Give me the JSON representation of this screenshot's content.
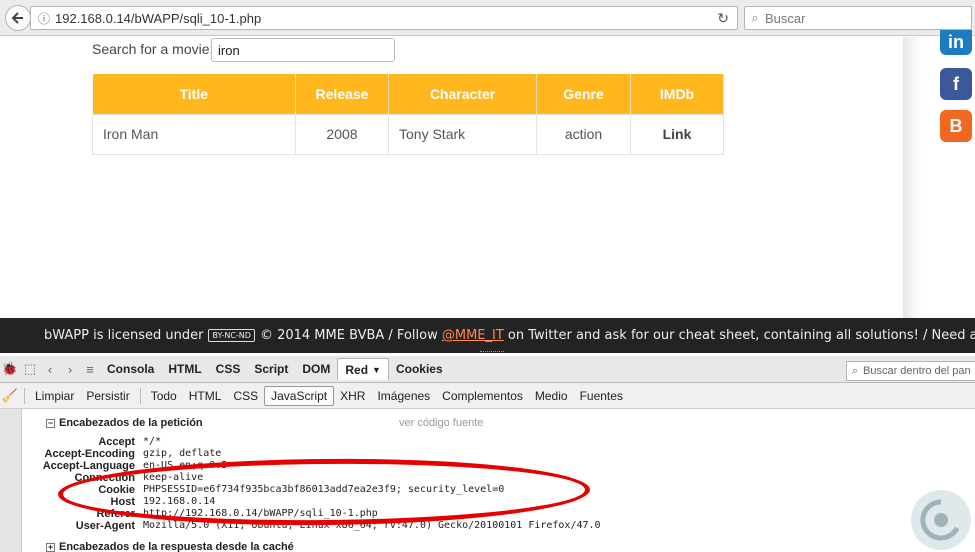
{
  "browser": {
    "url": "192.168.0.14/bWAPP/sqli_10-1.php",
    "search_placeholder": "Buscar"
  },
  "page": {
    "search_label": "Search for a movie:",
    "search_value": "iron",
    "table": {
      "headers": [
        "Title",
        "Release",
        "Character",
        "Genre",
        "IMDb"
      ],
      "rows": [
        [
          "Iron Man",
          "2008",
          "Tony Stark",
          "action",
          "Link"
        ]
      ]
    },
    "social": [
      "in",
      "f",
      "B"
    ]
  },
  "footer": {
    "text_before": "bWAPP is licensed under",
    "cc_badge": "BY-NC-ND",
    "text_middle": "© 2014 MME BVBA / Follow",
    "twitter": "@MME_IT",
    "text_after": "on Twitter and ask for our cheat sheet, containing all solutions! / Need an"
  },
  "firebug": {
    "tabs": [
      "Consola",
      "HTML",
      "CSS",
      "Script",
      "DOM",
      "Red",
      "Cookies"
    ],
    "active_tab": "Red",
    "search_placeholder": "Buscar dentro del pan",
    "sub_buttons": [
      "Limpiar",
      "Persistir",
      "Todo",
      "HTML",
      "CSS",
      "JavaScript",
      "XHR",
      "Imágenes",
      "Complementos",
      "Medio",
      "Fuentes"
    ],
    "active_sub": "JavaScript",
    "request_section": "Encabezados de la petición",
    "view_source": "ver código fuente",
    "headers": [
      {
        "name": "Accept",
        "value": "*/*"
      },
      {
        "name": "Accept-Encoding",
        "value": "gzip, deflate"
      },
      {
        "name": "Accept-Language",
        "value": "en-US,en;q=0.5"
      },
      {
        "name": "Connection",
        "value": "keep-alive"
      },
      {
        "name": "Cookie",
        "value": "PHPSESSID=e6f734f935bca3bf86013add7ea2e3f9; security_level=0"
      },
      {
        "name": "Host",
        "value": "192.168.0.14"
      },
      {
        "name": "Referer",
        "value": "http://192.168.0.14/bWAPP/sqli_10-1.php"
      },
      {
        "name": "User-Agent",
        "value": "Mozilla/5.0 (X11; Ubuntu; Linux x86_64; rv:47.0) Gecko/20100101 Firefox/47.0"
      }
    ],
    "cache_section": "Encabezados de la respuesta desde la caché"
  },
  "colors": {
    "accent": "#ffb71d",
    "annotation": "#e60000",
    "footer_bg": "#232323"
  }
}
